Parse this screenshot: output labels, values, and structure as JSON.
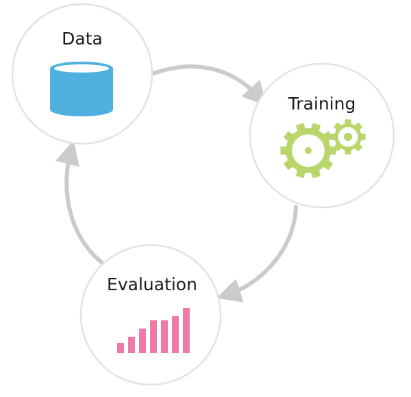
{
  "nodes": {
    "data": {
      "label": "Data",
      "icon": "database-icon",
      "color": "#4FB0DF"
    },
    "training": {
      "label": "Training",
      "icon": "gears-icon",
      "color": "#B9D66B"
    },
    "evaluation": {
      "label": "Evaluation",
      "icon": "bar-chart-icon",
      "color": "#EF7AA6"
    }
  },
  "evaluation_bars": [
    1,
    1.6,
    2.4,
    3.2,
    3.2,
    3.6,
    4.4
  ],
  "colors": {
    "circle_stroke": "#E2E2E2",
    "arrow": "#CBCBCB",
    "label": "#1C1C1C"
  }
}
